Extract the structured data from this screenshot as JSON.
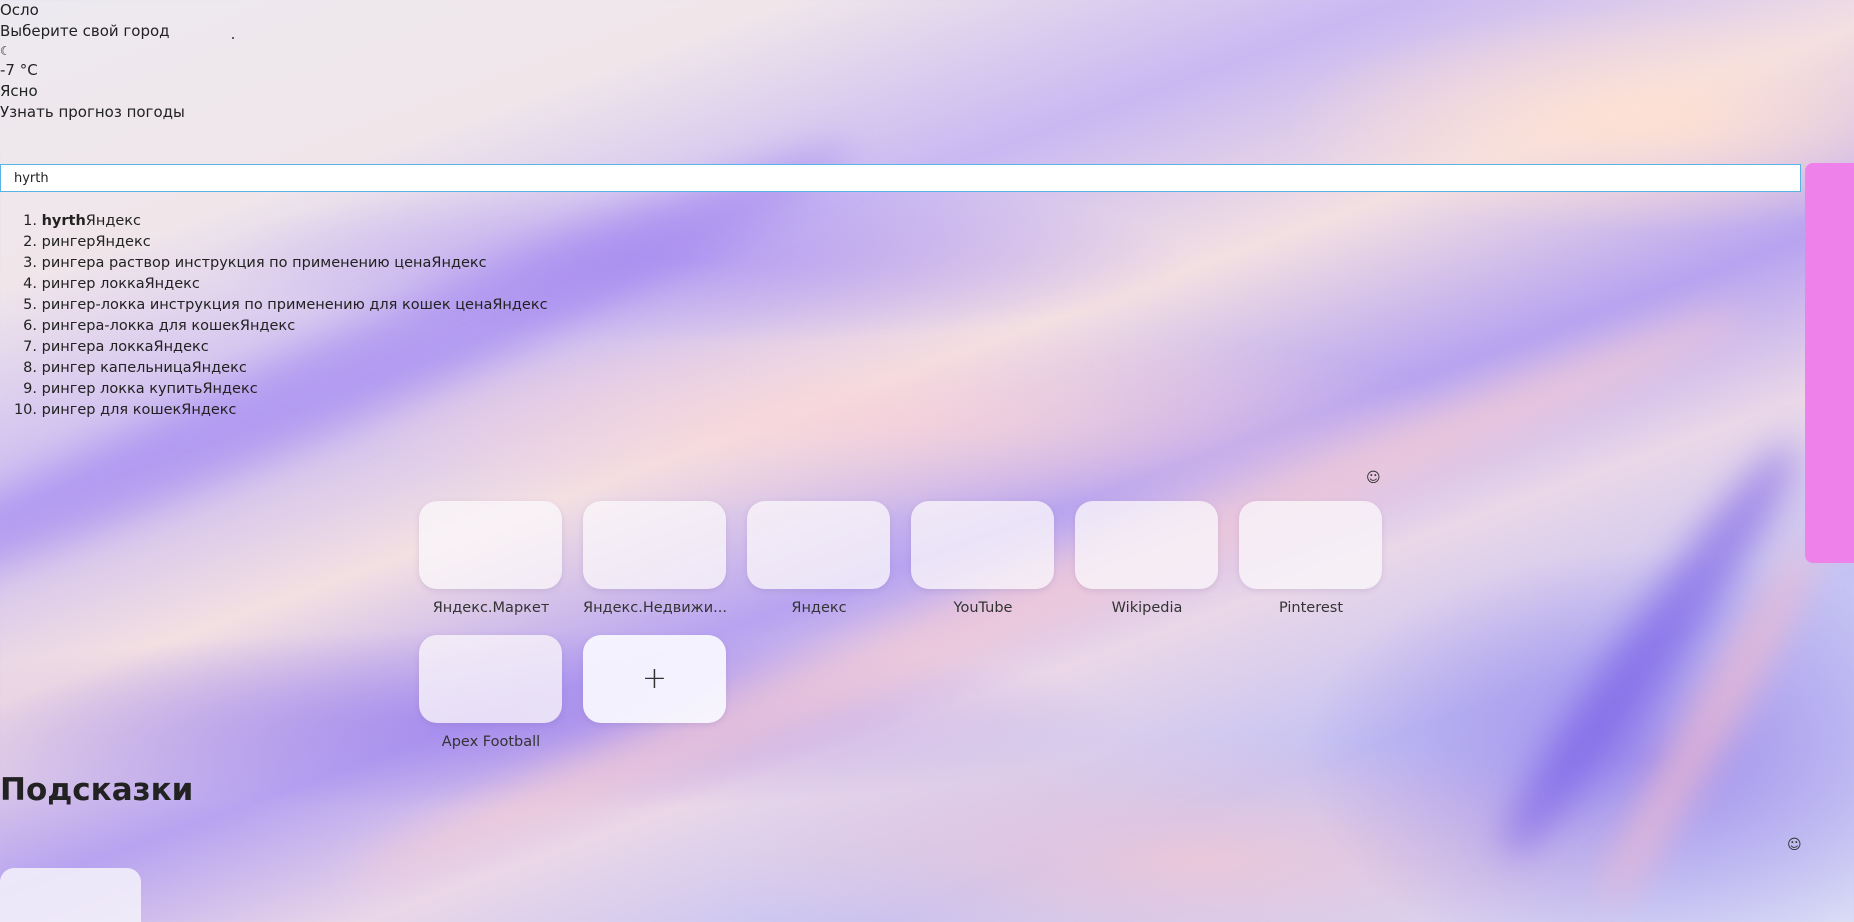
{
  "weather": {
    "city": "Осло",
    "choose_city": "Выберите свой город",
    "moon_icon": "☾",
    "temperature": "-7 °C",
    "condition": "Ясно",
    "forecast_link": "Узнать прогноз погоды"
  },
  "search": {
    "value": "hyrth"
  },
  "suggestions": [
    {
      "num": "1.",
      "bold": "hyrth",
      "text": "Яндекс"
    },
    {
      "num": "2.",
      "bold": "",
      "text": "рингерЯндекс"
    },
    {
      "num": "3.",
      "bold": "",
      "text": "рингера раствор инструкция по применению ценаЯндекс"
    },
    {
      "num": "4.",
      "bold": "",
      "text": "рингер локкаЯндекс"
    },
    {
      "num": "5.",
      "bold": "",
      "text": "рингер-локка инструкция по применению для кошек ценаЯндекс"
    },
    {
      "num": "6.",
      "bold": "",
      "text": "рингера-локка для кошекЯндекс"
    },
    {
      "num": "7.",
      "bold": "",
      "text": "рингера локкаЯндекс"
    },
    {
      "num": "8.",
      "bold": "",
      "text": "рингер капельницаЯндекс"
    },
    {
      "num": "9.",
      "bold": "",
      "text": "рингер локка купитьЯндекс"
    },
    {
      "num": "10.",
      "bold": "",
      "text": "рингер для кошекЯндекс"
    }
  ],
  "tiles": [
    {
      "label": "Яндекс.Маркет"
    },
    {
      "label": "Яндекс.Недвижи..."
    },
    {
      "label": "Яндекс"
    },
    {
      "label": "YouTube"
    },
    {
      "label": "Wikipedia"
    },
    {
      "label": "Pinterest"
    },
    {
      "label": "Apex Football"
    }
  ],
  "add_tile": {
    "icon": "+"
  },
  "icons": {
    "smile": "☺"
  },
  "hints": {
    "title": "Подсказки"
  },
  "colors": {
    "search_border": "#5ab3e6",
    "side_panel": "#ee82ea"
  }
}
